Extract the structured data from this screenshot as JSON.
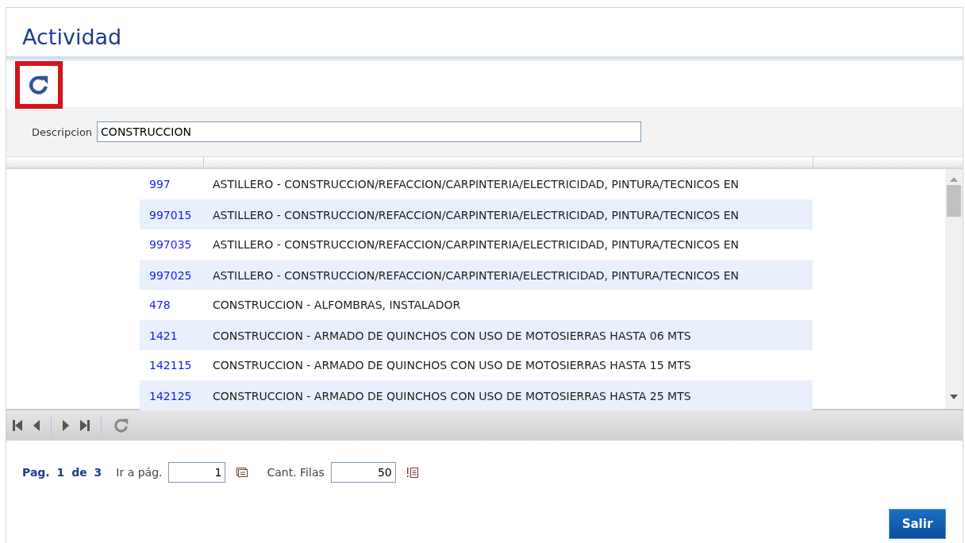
{
  "window": {
    "title": "Actividad"
  },
  "filter": {
    "label": "Descripcion",
    "value": "CONSTRUCCION"
  },
  "table": {
    "rows": [
      {
        "code": "997",
        "description": "ASTILLERO - CONSTRUCCION/REFACCION/CARPINTERIA/ELECTRICIDAD, PINTURA/TECNICOS EN"
      },
      {
        "code": "997015",
        "description": "ASTILLERO - CONSTRUCCION/REFACCION/CARPINTERIA/ELECTRICIDAD, PINTURA/TECNICOS EN"
      },
      {
        "code": "997035",
        "description": "ASTILLERO - CONSTRUCCION/REFACCION/CARPINTERIA/ELECTRICIDAD, PINTURA/TECNICOS EN"
      },
      {
        "code": "997025",
        "description": "ASTILLERO - CONSTRUCCION/REFACCION/CARPINTERIA/ELECTRICIDAD, PINTURA/TECNICOS EN"
      },
      {
        "code": "478",
        "description": "CONSTRUCCION - ALFOMBRAS, INSTALADOR"
      },
      {
        "code": "1421",
        "description": "CONSTRUCCION - ARMADO DE QUINCHOS CON USO DE MOTOSIERRAS HASTA 06 MTS"
      },
      {
        "code": "142115",
        "description": "CONSTRUCCION - ARMADO DE QUINCHOS CON USO DE MOTOSIERRAS HASTA 15 MTS"
      },
      {
        "code": "142125",
        "description": "CONSTRUCCION - ARMADO DE QUINCHOS CON USO DE MOTOSIERRAS HASTA 25 MTS"
      }
    ]
  },
  "pager": {
    "page_info": "Pag. 1 de 3",
    "goto_label": "Ir a pág.",
    "goto_value": "1",
    "rows_label": "Cant. Filas",
    "rows_value": "50"
  },
  "buttons": [
    "Salir"
  ]
}
